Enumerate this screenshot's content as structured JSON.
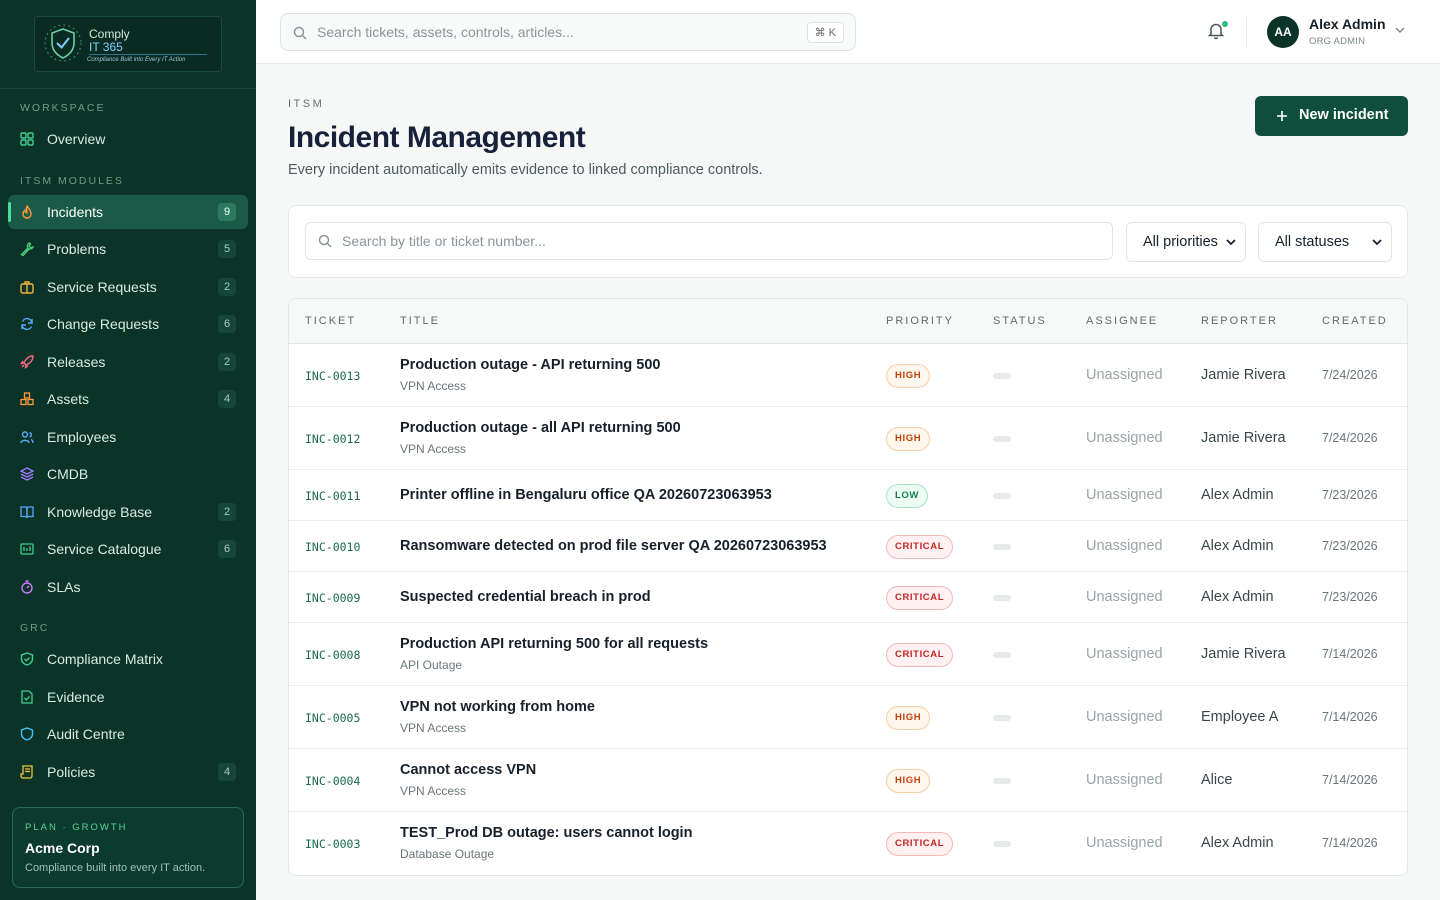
{
  "brand": {
    "line1": "Comply",
    "line2": "IT 365",
    "tagline": "Compliance Built into Every IT Action"
  },
  "sidebar": {
    "sections": [
      {
        "label": "WORKSPACE",
        "items": [
          {
            "label": "Overview",
            "icon": "grid-icon",
            "count": ""
          }
        ]
      },
      {
        "label": "ITSM MODULES",
        "items": [
          {
            "label": "Incidents",
            "icon": "flame-icon",
            "count": "9",
            "active": true
          },
          {
            "label": "Problems",
            "icon": "wrench-icon",
            "count": "5"
          },
          {
            "label": "Service Requests",
            "icon": "briefcase-icon",
            "count": "2"
          },
          {
            "label": "Change Requests",
            "icon": "refresh-icon",
            "count": "6"
          },
          {
            "label": "Releases",
            "icon": "rocket-icon",
            "count": "2"
          },
          {
            "label": "Assets",
            "icon": "boxes-icon",
            "count": "4"
          },
          {
            "label": "Employees",
            "icon": "users-icon",
            "count": ""
          },
          {
            "label": "CMDB",
            "icon": "layers-icon",
            "count": ""
          },
          {
            "label": "Knowledge Base",
            "icon": "book-icon",
            "count": "2"
          },
          {
            "label": "Service Catalogue",
            "icon": "catalogue-icon",
            "count": "6"
          },
          {
            "label": "SLAs",
            "icon": "timer-icon",
            "count": ""
          }
        ]
      },
      {
        "label": "GRC",
        "items": [
          {
            "label": "Compliance Matrix",
            "icon": "shield-check-icon",
            "count": ""
          },
          {
            "label": "Evidence",
            "icon": "file-check-icon",
            "count": ""
          },
          {
            "label": "Audit Centre",
            "icon": "shield-icon",
            "count": ""
          },
          {
            "label": "Policies",
            "icon": "scroll-icon",
            "count": "4"
          }
        ]
      }
    ],
    "plan": {
      "label": "PLAN · GROWTH",
      "org": "Acme Corp",
      "tagline": "Compliance built into every IT action."
    }
  },
  "topbar": {
    "search_placeholder": "Search tickets, assets, controls, articles...",
    "shortcut": "⌘ K",
    "user": {
      "initials": "AA",
      "name": "Alex Admin",
      "role": "ORG ADMIN"
    }
  },
  "header": {
    "eyebrow": "ITSM",
    "title": "Incident Management",
    "subtitle": "Every incident automatically emits evidence to linked compliance controls.",
    "new_button": "New incident"
  },
  "filters": {
    "search_placeholder": "Search by title or ticket number...",
    "priority": "All priorities",
    "status": "All statuses"
  },
  "table": {
    "columns": [
      "TICKET",
      "TITLE",
      "PRIORITY",
      "STATUS",
      "ASSIGNEE",
      "REPORTER",
      "CREATED"
    ],
    "rows": [
      {
        "id": "INC-0013",
        "title": "Production outage - API returning 500",
        "category": "VPN Access",
        "priority": "HIGH",
        "priority_level": "high",
        "assignee": "Unassigned",
        "reporter": "Jamie Rivera",
        "created": "7/24/2026"
      },
      {
        "id": "INC-0012",
        "title": "Production outage - all API returning 500",
        "category": "VPN Access",
        "priority": "HIGH",
        "priority_level": "high",
        "assignee": "Unassigned",
        "reporter": "Jamie Rivera",
        "created": "7/24/2026"
      },
      {
        "id": "INC-0011",
        "title": "Printer offline in Bengaluru office QA 20260723063953",
        "category": "",
        "priority": "LOW",
        "priority_level": "low",
        "assignee": "Unassigned",
        "reporter": "Alex Admin",
        "created": "7/23/2026"
      },
      {
        "id": "INC-0010",
        "title": "Ransomware detected on prod file server QA 20260723063953",
        "category": "",
        "priority": "CRITICAL",
        "priority_level": "critical",
        "assignee": "Unassigned",
        "reporter": "Alex Admin",
        "created": "7/23/2026"
      },
      {
        "id": "INC-0009",
        "title": "Suspected credential breach in prod",
        "category": "",
        "priority": "CRITICAL",
        "priority_level": "critical",
        "assignee": "Unassigned",
        "reporter": "Alex Admin",
        "created": "7/23/2026"
      },
      {
        "id": "INC-0008",
        "title": "Production API returning 500 for all requests",
        "category": "API Outage",
        "priority": "CRITICAL",
        "priority_level": "critical",
        "assignee": "Unassigned",
        "reporter": "Jamie Rivera",
        "created": "7/14/2026"
      },
      {
        "id": "INC-0005",
        "title": "VPN not working from home",
        "category": "VPN Access",
        "priority": "HIGH",
        "priority_level": "high",
        "assignee": "Unassigned",
        "reporter": "Employee A",
        "created": "7/14/2026"
      },
      {
        "id": "INC-0004",
        "title": "Cannot access VPN",
        "category": "VPN Access",
        "priority": "HIGH",
        "priority_level": "high",
        "assignee": "Unassigned",
        "reporter": "Alice",
        "created": "7/14/2026"
      },
      {
        "id": "INC-0003",
        "title": "TEST_Prod DB outage: users cannot login",
        "category": "Database Outage",
        "priority": "CRITICAL",
        "priority_level": "critical",
        "assignee": "Unassigned",
        "reporter": "Alex Admin",
        "created": "7/14/2026"
      }
    ]
  },
  "colors": {
    "sidebar_bg": "#0c3328",
    "accent": "#0f4f3c",
    "active_indicator": "#4ddb9a"
  }
}
